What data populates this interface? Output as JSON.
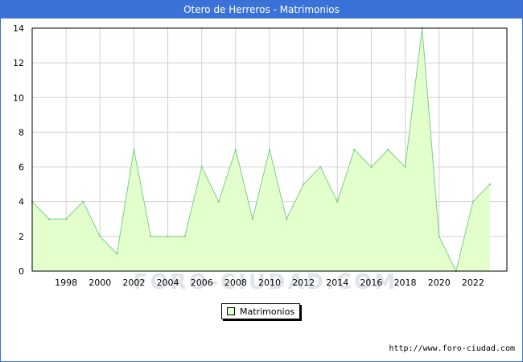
{
  "header": {
    "title": "Otero de Herreros - Matrimonios"
  },
  "legend": {
    "label": "Matrimonios"
  },
  "footer": {
    "source": "http://www.foro-ciudad.com"
  },
  "watermark": "FORO-CIUDAD.COM",
  "colors": {
    "fill": "#e2ffcc",
    "line": "#7ccf87",
    "title_bg": "#3a72d8",
    "grid": "#d0d0d0"
  },
  "chart_data": {
    "type": "area",
    "x": [
      1996,
      1997,
      1998,
      1999,
      2000,
      2001,
      2002,
      2003,
      2004,
      2005,
      2006,
      2007,
      2008,
      2009,
      2010,
      2011,
      2012,
      2013,
      2014,
      2015,
      2016,
      2017,
      2018,
      2019,
      2020,
      2021,
      2022,
      2023
    ],
    "series": [
      {
        "name": "Matrimonios",
        "values": [
          4,
          3,
          3,
          4,
          2,
          1,
          7,
          2,
          2,
          2,
          6,
          4,
          7,
          3,
          7,
          3,
          5,
          6,
          4,
          7,
          6,
          7,
          6,
          14,
          2,
          0,
          4,
          5
        ]
      }
    ],
    "x_ticks": [
      1998,
      2000,
      2002,
      2004,
      2006,
      2008,
      2010,
      2012,
      2014,
      2016,
      2018,
      2020,
      2022
    ],
    "y_ticks": [
      0,
      2,
      4,
      6,
      8,
      10,
      12,
      14
    ],
    "xlim": [
      1996,
      2024
    ],
    "ylim": [
      0,
      14
    ],
    "grid": true,
    "legend_position": "bottom-center"
  }
}
